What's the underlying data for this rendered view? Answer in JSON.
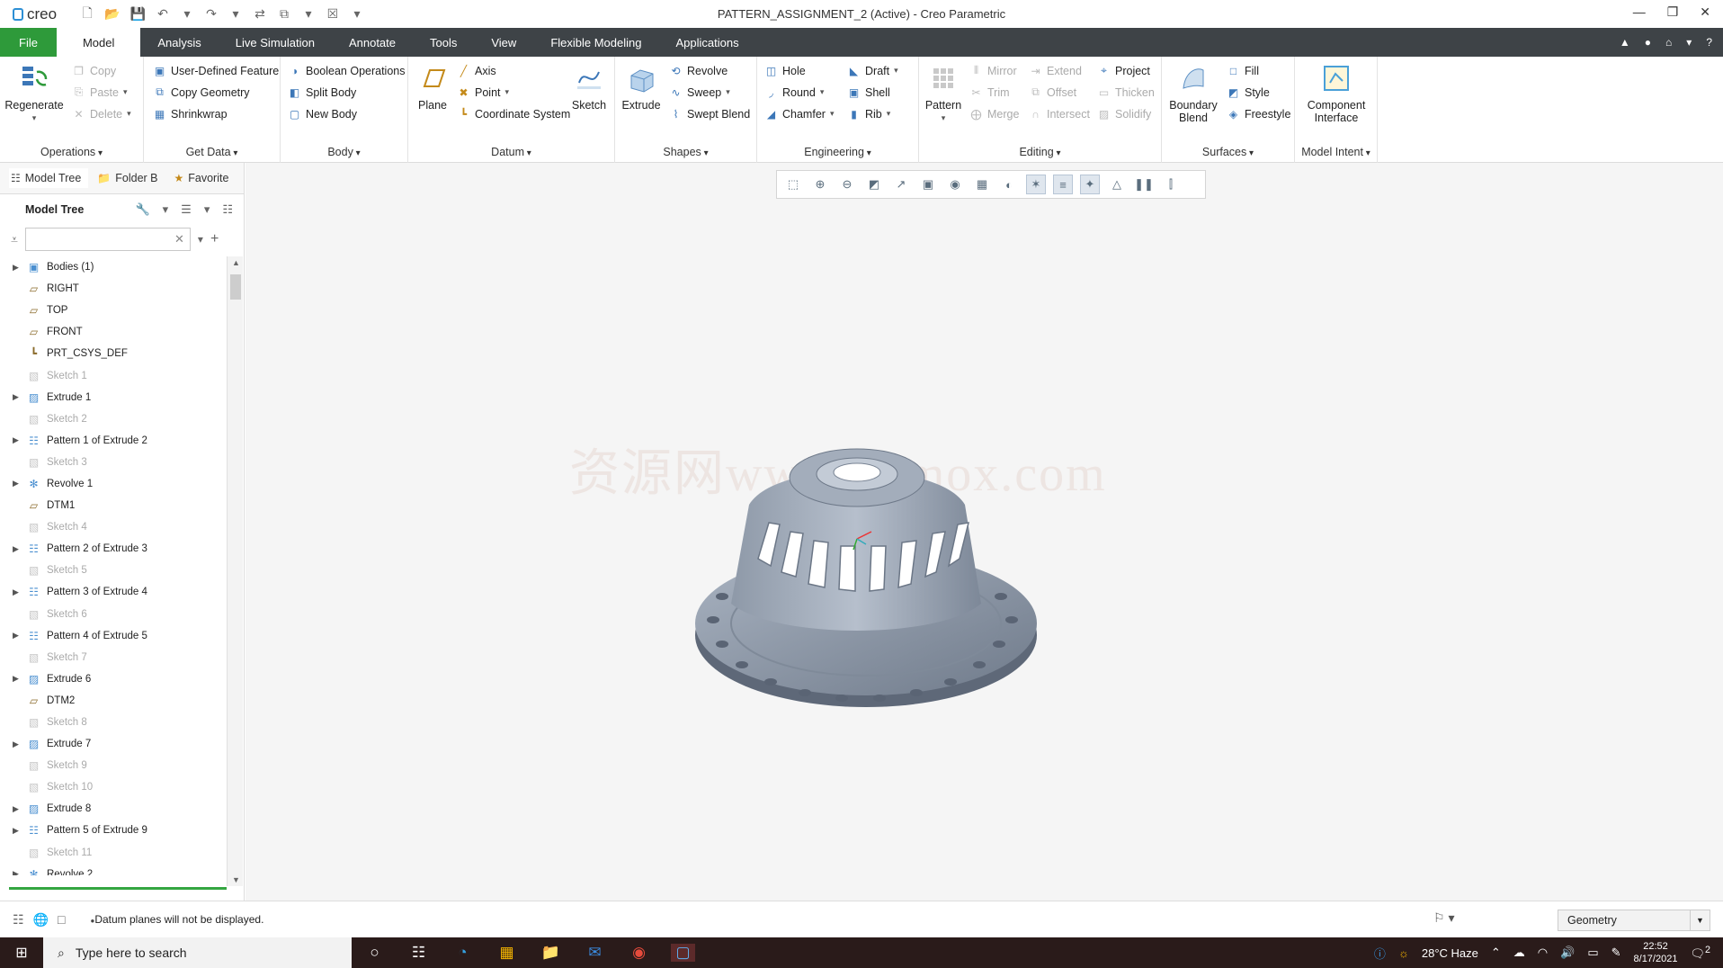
{
  "window": {
    "app_name": "creo",
    "title": "PATTERN_ASSIGNMENT_2 (Active) - Creo Parametric"
  },
  "menu": {
    "tabs": [
      "File",
      "Model",
      "Analysis",
      "Live Simulation",
      "Annotate",
      "Tools",
      "View",
      "Flexible Modeling",
      "Applications"
    ],
    "active": "Model"
  },
  "ribbon": {
    "operations": {
      "label": "Operations",
      "regenerate": "Regenerate",
      "copy": "Copy",
      "paste": "Paste",
      "delete": "Delete"
    },
    "get_data": {
      "label": "Get Data",
      "udf": "User-Defined Feature",
      "copy_geometry": "Copy Geometry",
      "shrinkwrap": "Shrinkwrap"
    },
    "body": {
      "label": "Body",
      "boolean": "Boolean Operations",
      "split": "Split Body",
      "new": "New Body"
    },
    "datum": {
      "label": "Datum",
      "plane": "Plane",
      "axis": "Axis",
      "point": "Point",
      "csys": "Coordinate System",
      "sketch": "Sketch"
    },
    "shapes": {
      "label": "Shapes",
      "extrude": "Extrude",
      "revolve": "Revolve",
      "sweep": "Sweep",
      "swept_blend": "Swept Blend"
    },
    "engineering": {
      "label": "Engineering",
      "hole": "Hole",
      "round": "Round",
      "chamfer": "Chamfer",
      "draft": "Draft",
      "shell": "Shell",
      "rib": "Rib"
    },
    "editing": {
      "label": "Editing",
      "pattern": "Pattern",
      "mirror": "Mirror",
      "trim": "Trim",
      "merge": "Merge",
      "extend": "Extend",
      "offset": "Offset",
      "intersect": "Intersect",
      "project": "Project",
      "thicken": "Thicken",
      "solidify": "Solidify"
    },
    "surfaces": {
      "label": "Surfaces",
      "boundary_blend": "Boundary Blend",
      "fill": "Fill",
      "style": "Style",
      "freestyle": "Freestyle"
    },
    "model_intent": {
      "label": "Model Intent",
      "component_interface": "Component Interface"
    }
  },
  "panel": {
    "tabs": [
      "Model Tree",
      "Folder B",
      "Favorite"
    ],
    "header": "Model Tree",
    "search_placeholder": ""
  },
  "tree": [
    {
      "label": "Bodies (1)",
      "icon": "bodies-icon",
      "expandable": true,
      "dim": false
    },
    {
      "label": "RIGHT",
      "icon": "datum-plane-icon",
      "expandable": false,
      "dim": false
    },
    {
      "label": "TOP",
      "icon": "datum-plane-icon",
      "expandable": false,
      "dim": false
    },
    {
      "label": "FRONT",
      "icon": "datum-plane-icon",
      "expandable": false,
      "dim": false
    },
    {
      "label": "PRT_CSYS_DEF",
      "icon": "csys-icon",
      "expandable": false,
      "dim": false
    },
    {
      "label": "Sketch 1",
      "icon": "sketch-icon",
      "expandable": false,
      "dim": true
    },
    {
      "label": "Extrude 1",
      "icon": "extrude-icon",
      "expandable": true,
      "dim": false
    },
    {
      "label": "Sketch 2",
      "icon": "sketch-icon",
      "expandable": false,
      "dim": true
    },
    {
      "label": "Pattern 1 of Extrude 2",
      "icon": "pattern-icon",
      "expandable": true,
      "dim": false
    },
    {
      "label": "Sketch 3",
      "icon": "sketch-icon",
      "expandable": false,
      "dim": true
    },
    {
      "label": "Revolve 1",
      "icon": "revolve-icon",
      "expandable": true,
      "dim": false
    },
    {
      "label": "DTM1",
      "icon": "datum-plane-icon",
      "expandable": false,
      "dim": false
    },
    {
      "label": "Sketch 4",
      "icon": "sketch-icon",
      "expandable": false,
      "dim": true
    },
    {
      "label": "Pattern 2 of Extrude 3",
      "icon": "pattern-icon",
      "expandable": true,
      "dim": false
    },
    {
      "label": "Sketch 5",
      "icon": "sketch-icon",
      "expandable": false,
      "dim": true
    },
    {
      "label": "Pattern 3 of Extrude 4",
      "icon": "pattern-icon",
      "expandable": true,
      "dim": false
    },
    {
      "label": "Sketch 6",
      "icon": "sketch-icon",
      "expandable": false,
      "dim": true
    },
    {
      "label": "Pattern 4 of Extrude 5",
      "icon": "pattern-icon",
      "expandable": true,
      "dim": false
    },
    {
      "label": "Sketch 7",
      "icon": "sketch-icon",
      "expandable": false,
      "dim": true
    },
    {
      "label": "Extrude 6",
      "icon": "extrude-icon",
      "expandable": true,
      "dim": false
    },
    {
      "label": "DTM2",
      "icon": "datum-plane-icon",
      "expandable": false,
      "dim": false
    },
    {
      "label": "Sketch 8",
      "icon": "sketch-icon",
      "expandable": false,
      "dim": true
    },
    {
      "label": "Extrude 7",
      "icon": "extrude-icon",
      "expandable": true,
      "dim": false
    },
    {
      "label": "Sketch 9",
      "icon": "sketch-icon",
      "expandable": false,
      "dim": true
    },
    {
      "label": "Sketch 10",
      "icon": "sketch-icon",
      "expandable": false,
      "dim": true
    },
    {
      "label": "Extrude 8",
      "icon": "extrude-icon",
      "expandable": true,
      "dim": false
    },
    {
      "label": "Pattern 5 of Extrude 9",
      "icon": "pattern-icon",
      "expandable": true,
      "dim": false
    },
    {
      "label": "Sketch 11",
      "icon": "sketch-icon",
      "expandable": false,
      "dim": true
    },
    {
      "label": "Revolve 2",
      "icon": "revolve-icon",
      "expandable": true,
      "dim": false
    }
  ],
  "viewport": {
    "watermark": "资源网www.3dmox.com"
  },
  "status": {
    "message": "Datum planes will not be displayed.",
    "selection_filter": "Geometry"
  },
  "taskbar": {
    "search_placeholder": "Type here to search",
    "weather": "28°C Haze",
    "time": "22:52",
    "date": "8/17/2021",
    "notification_count": "2"
  },
  "colors": {
    "file_tab": "#2e9a3a",
    "menubar": "#3e4347",
    "accent": "#3c77b8"
  }
}
